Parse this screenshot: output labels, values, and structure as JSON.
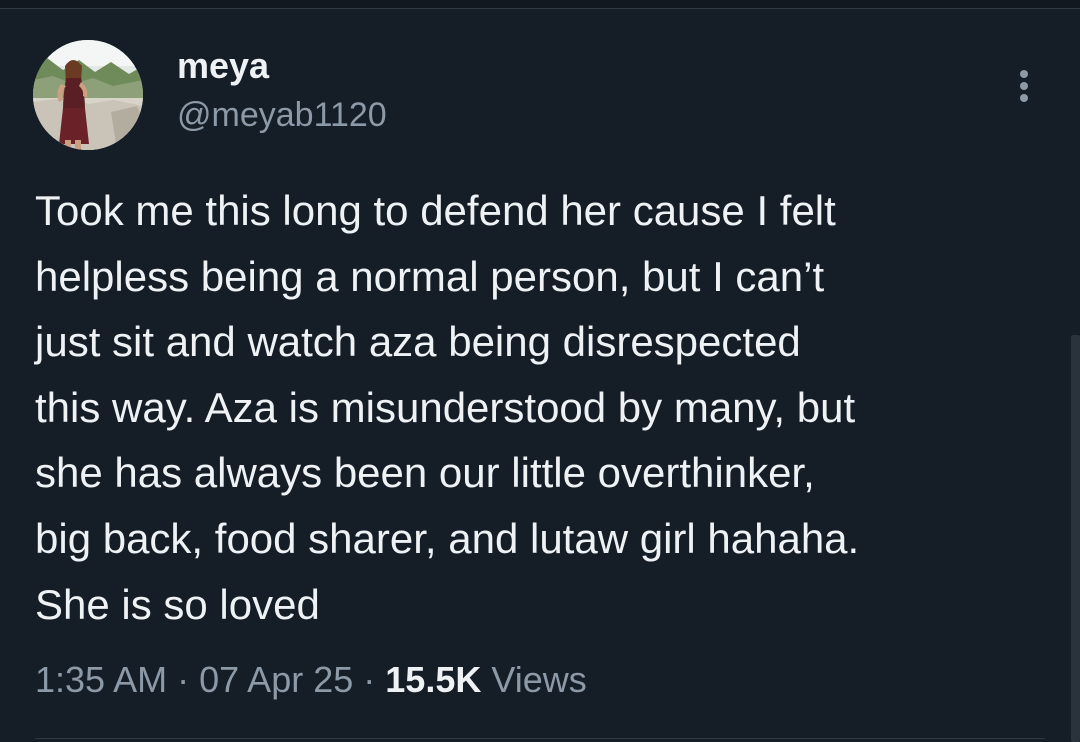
{
  "author": {
    "display_name": "meya",
    "handle": "@meyab1120",
    "avatar_icon": "profile-photo"
  },
  "more_icon": "more-vertical-icon",
  "tweet": {
    "text": "Took me this long to defend her cause I felt\nhelpless being a normal person, but I can’t\njust sit and watch aza being disrespected\nthis way. Aza is misunderstood by many, but\nshe has always been our little overthinker,\nbig back, food sharer, and lutaw girl hahaha.\nShe is so loved"
  },
  "meta": {
    "time": "1:35 AM",
    "separator": "·",
    "date": "07 Apr 25",
    "views_count": "15.5K",
    "views_label": "Views"
  },
  "colors": {
    "background": "#151d27",
    "primary_text": "#eef2f5",
    "secondary_text": "#8c99a6",
    "divider": "#2d3945"
  }
}
